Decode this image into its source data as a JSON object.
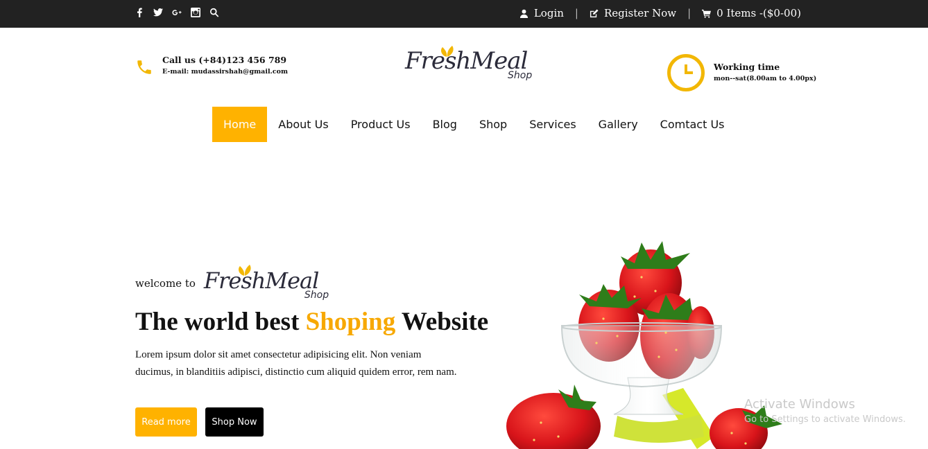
{
  "topbar": {
    "social_icons": [
      "facebook-icon",
      "twitter-icon",
      "google-plus-icon",
      "instagram-icon",
      "search-icon"
    ],
    "login": "Login",
    "register": "Register Now",
    "cart": "0 Items -($0-00)",
    "separator": "|"
  },
  "header": {
    "call": "Call us (+84)123 456 789",
    "email": "E-mail: mudassirshah@gmail.com",
    "logo_script": "FreshMeal",
    "logo_sub": "Shop",
    "work_title": "Working time",
    "work_hours": "mon--sat(8.00am to 4.00px)"
  },
  "nav": {
    "items": [
      "Home",
      "About Us",
      "Product Us",
      "Blog",
      "Shop",
      "Services",
      "Gallery",
      "Comtact Us"
    ]
  },
  "hero": {
    "welcome": "welcome to",
    "logo_script": "FreshMeal",
    "logo_sub": "Shop",
    "headline_pre": "The world best ",
    "headline_highlight": "Shoping",
    "headline_post": " Website",
    "body": "Lorem ipsum dolor sit amet consectetur adipisicing elit. Non veniam ducimus, in blanditiis adipisci, distinctio cum aliquid quidem error, rem nam.",
    "read_more": "Read more",
    "shop_now": "Shop Now"
  },
  "watermark": {
    "title": "Activate Windows",
    "subtitle": "Go to Settings to activate Windows."
  },
  "colors": {
    "accent": "#ffb200",
    "topbar": "#222222",
    "highlight_text": "#f7a800"
  }
}
